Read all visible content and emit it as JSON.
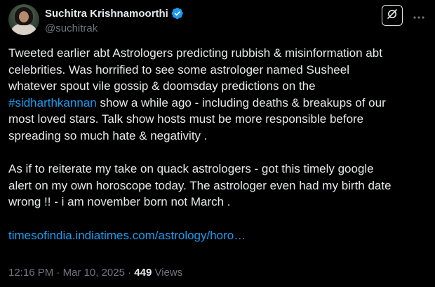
{
  "author": {
    "display_name": "Suchitra Krishnamoorthi",
    "handle": "@suchitrak",
    "verified": true,
    "verified_color": "#1d9bf0"
  },
  "actions": {
    "grok_icon": "grok-icon",
    "more_icon": "more-icon"
  },
  "tweet": {
    "para1_lines": [
      "Tweeted earlier abt Astrologers predicting rubbish & misinformation abt",
      "celebrities. Was horrified to see some astrologer named Susheel",
      "whatever spout vile gossip & doomsday predictions on the"
    ],
    "hashtag": "#sidharthkannan",
    "para1_after_hashtag": " show a while ago - including deaths & breakups of our",
    "para1_tail_lines": [
      "most loved stars. Talk show hosts must be more responsible before",
      "spreading so much hate & negativity ."
    ],
    "para2_lines": [
      "As if to reiterate my take on quack astrologers - got this timely google",
      "alert on my own horoscope today. The astrologer even had my birth date",
      "wrong !! - i am november born not March ."
    ],
    "link": "timesofindia.indiatimes.com/astrology/horo…"
  },
  "meta": {
    "time": "12:16 PM",
    "separator": " · ",
    "date": "Mar 10, 2025",
    "views": "449",
    "views_label": " Views"
  },
  "colors": {
    "background": "#000000",
    "text": "#e7e9ea",
    "secondary": "#71767b",
    "link": "#1d9bf0"
  }
}
